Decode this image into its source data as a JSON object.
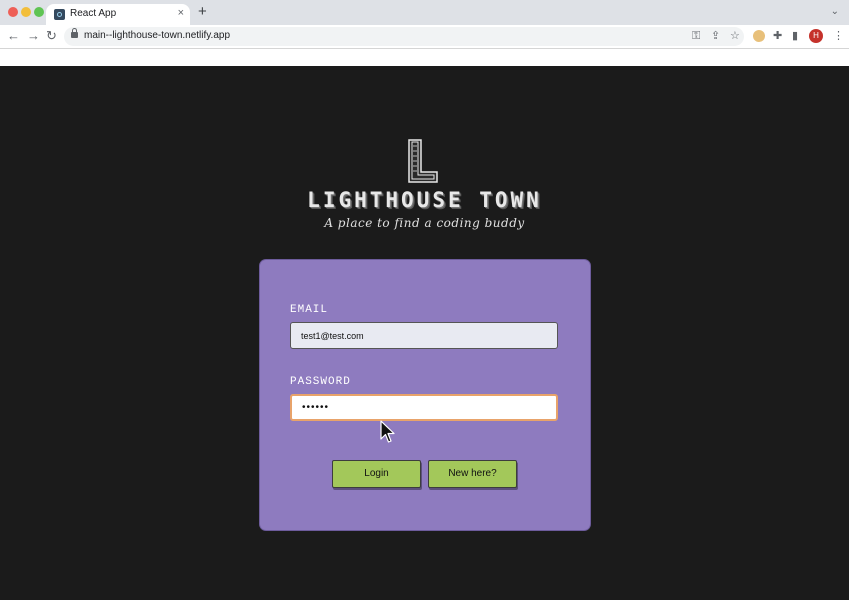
{
  "browser": {
    "tab_title": "React App",
    "tab_close": "×",
    "new_tab": "+",
    "tab_menu": "⌄",
    "url": "main--lighthouse-town.netlify.app",
    "profile_initial": "H",
    "icons": [
      "back-arrow-icon",
      "forward-arrow-icon",
      "reload-icon",
      "lock-icon",
      "key-icon",
      "share-icon",
      "star-icon",
      "extension-avatar-icon",
      "puzzle-icon",
      "sidebar-icon",
      "profile-avatar",
      "kebab-menu-icon"
    ]
  },
  "brand": {
    "logo_letter": "L",
    "title": "LIGHTHOUSE TOWN",
    "tagline": "A place to find a coding buddy"
  },
  "login": {
    "email_label": "EMAIL",
    "email_value": "test1@test.com",
    "password_label": "PASSWORD",
    "password_value": "••••••",
    "login_button": "Login",
    "signup_button": "New here?"
  },
  "colors": {
    "page_background": "#1b1b1b",
    "card_background": "#8e7bbf",
    "button_background": "#a3c85a",
    "focus_border": "#e8a36a"
  }
}
